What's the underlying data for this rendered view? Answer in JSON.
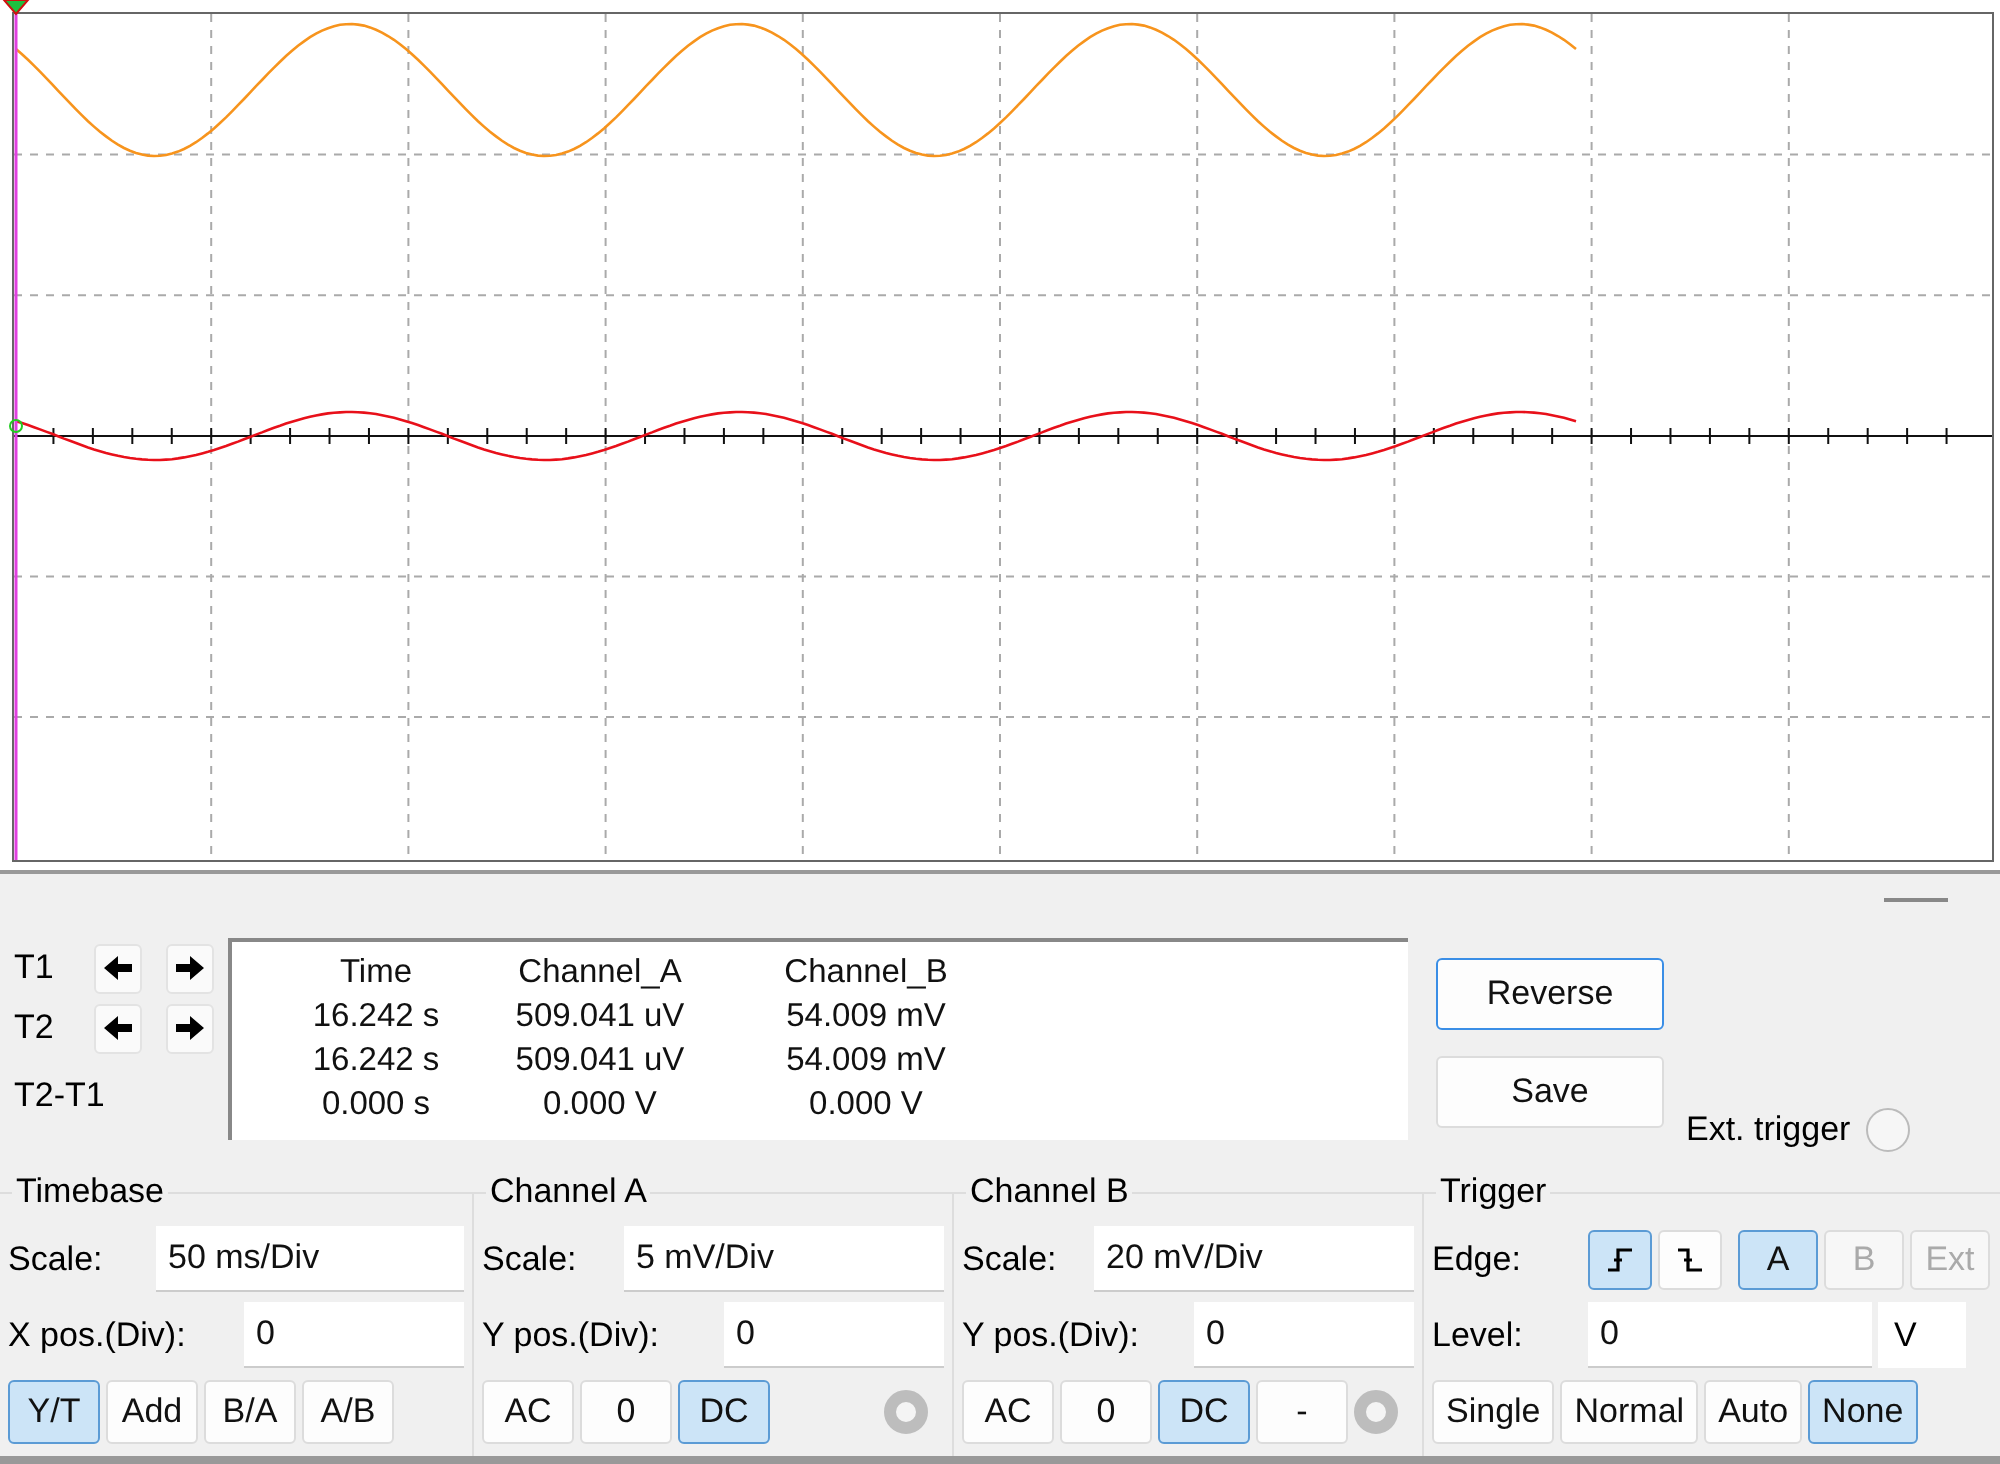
{
  "cursors": {
    "rows": [
      {
        "label": "T1",
        "arrows": true
      },
      {
        "label": "T2",
        "arrows": true
      },
      {
        "label": "T2-T1",
        "arrows": false
      }
    ]
  },
  "readout": {
    "columns": [
      "Time",
      "Channel_A",
      "Channel_B"
    ],
    "rows": [
      [
        "16.242 s",
        "509.041 uV",
        "54.009 mV"
      ],
      [
        "16.242 s",
        "509.041 uV",
        "54.009 mV"
      ],
      [
        "0.000 s",
        "0.000 V",
        "0.000 V"
      ]
    ]
  },
  "actions": [
    {
      "label": "Reverse",
      "focused": true
    },
    {
      "label": "Save",
      "focused": false
    }
  ],
  "ext_trigger": {
    "label": "Ext. trigger",
    "checked": false
  },
  "groups": [
    {
      "kind": "timebase",
      "title": "Timebase",
      "fields": [
        {
          "label": "Scale:",
          "value": "50 ms/Div"
        },
        {
          "label": "X pos.(Div):",
          "value": "0"
        }
      ],
      "buttons": [
        {
          "label": "Y/T",
          "selected": true
        },
        {
          "label": "Add",
          "selected": false
        },
        {
          "label": "B/A",
          "selected": false
        },
        {
          "label": "A/B",
          "selected": false
        }
      ]
    },
    {
      "kind": "channel",
      "title": "Channel A",
      "fields": [
        {
          "label": "Scale:",
          "value": "5 mV/Div"
        },
        {
          "label": "Y pos.(Div):",
          "value": "0"
        }
      ],
      "buttons": [
        {
          "label": "AC",
          "selected": false
        },
        {
          "label": "0",
          "selected": false
        },
        {
          "label": "DC",
          "selected": true
        }
      ]
    },
    {
      "kind": "channel",
      "title": "Channel B",
      "fields": [
        {
          "label": "Scale:",
          "value": "20 mV/Div"
        },
        {
          "label": "Y pos.(Div):",
          "value": "0"
        }
      ],
      "buttons": [
        {
          "label": "AC",
          "selected": false
        },
        {
          "label": "0",
          "selected": false
        },
        {
          "label": "DC",
          "selected": true
        },
        {
          "label": "-",
          "selected": false
        }
      ]
    }
  ],
  "trigger": {
    "title": "Trigger",
    "edge_label": "Edge:",
    "edges": [
      {
        "kind": "rising",
        "selected": true
      },
      {
        "kind": "falling",
        "selected": false
      }
    ],
    "sources": [
      {
        "label": "A",
        "selected": true,
        "disabled": false
      },
      {
        "label": "B",
        "selected": false,
        "disabled": true
      },
      {
        "label": "Ext",
        "selected": false,
        "disabled": true
      }
    ],
    "level_label": "Level:",
    "level_value": "0",
    "level_unit": "V",
    "modes": [
      {
        "label": "Single",
        "selected": false
      },
      {
        "label": "Normal",
        "selected": false
      },
      {
        "label": "Auto",
        "selected": false
      },
      {
        "label": "None",
        "selected": true
      }
    ]
  }
}
